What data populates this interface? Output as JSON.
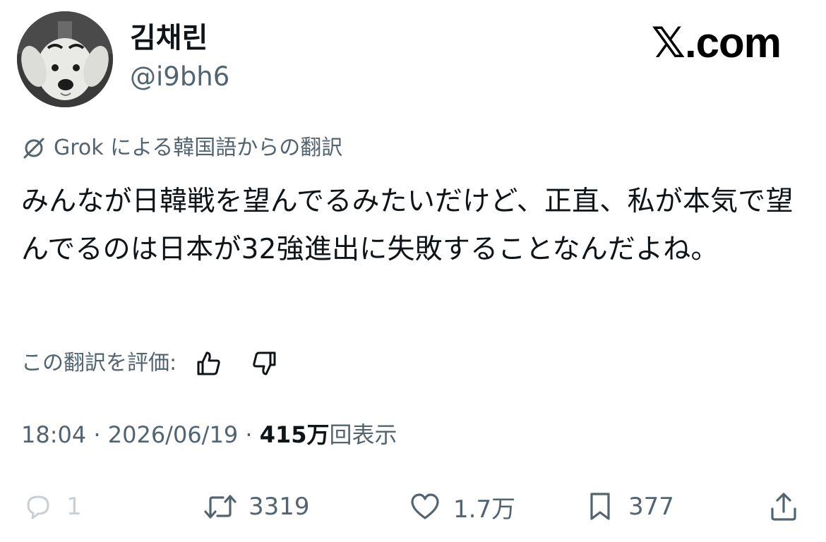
{
  "author": {
    "display_name": "김채린",
    "handle": "@i9bh6",
    "avatar": "dog-avatar"
  },
  "brand": {
    "logo_text": "𝕏.com"
  },
  "translation": {
    "icon": "grok-icon",
    "note": "Grok による韓国語からの翻訳"
  },
  "tweet": {
    "text": "みんなが日韓戦を望んでるみたいだけど、正直、私が本気で望んでるのは日本が32強進出に失敗することなんだよね。"
  },
  "rating": {
    "label": "この翻訳を評価:",
    "up_icon": "thumbs-up-icon",
    "down_icon": "thumbs-down-icon"
  },
  "meta": {
    "time": "18:04",
    "separator": "·",
    "date": "2026/06/19",
    "views_count": "415万",
    "views_label": "回表示"
  },
  "actions": {
    "reply_count": "1",
    "retweet_count": "3319",
    "like_count": "1.7万",
    "bookmark_count": "377"
  },
  "colors": {
    "text": "#0f1419",
    "secondary": "#536471",
    "background": "#ffffff"
  }
}
